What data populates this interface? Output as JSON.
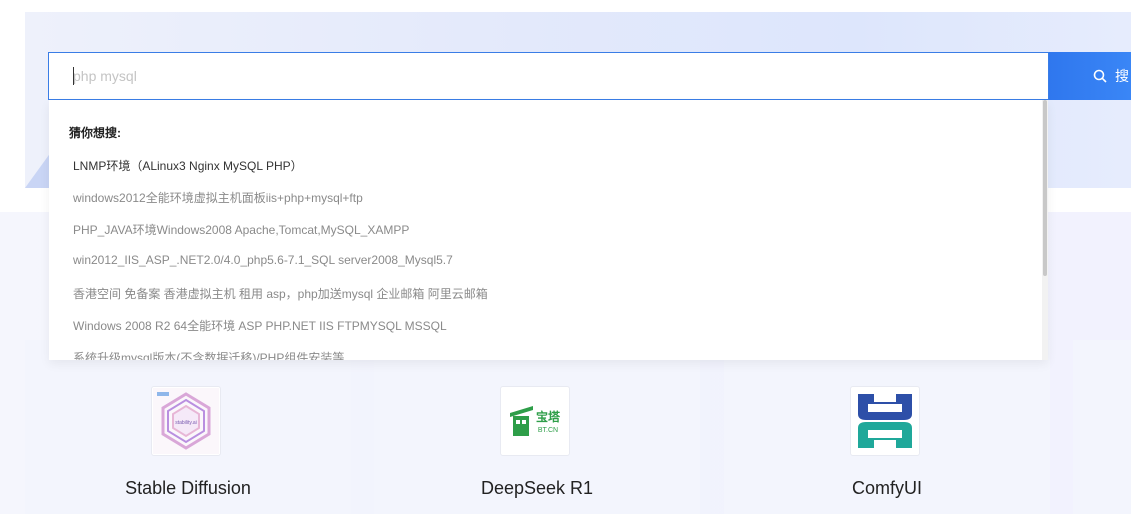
{
  "search": {
    "value": "",
    "placeholder": "php mysql",
    "button_label": "搜"
  },
  "suggestions": {
    "heading": "猜你想搜:",
    "items": [
      "LNMP环境（ALinux3 Nginx MySQL PHP）",
      "windows2012全能环境虚拟主机面板iis+php+mysql+ftp",
      "PHP_JAVA环境Windows2008 Apache,Tomcat,MySQL_XAMPP",
      "win2012_IIS_ASP_.NET2.0/4.0_php5.6-7.1_SQL server2008_Mysql5.7",
      "香港空间 免备案 香港虚拟主机 租用 asp，php加送mysql 企业邮箱 阿里云邮箱",
      "Windows 2008 R2 64全能环境 ASP PHP.NET IIS FTPMYSQL MSSQL",
      "系统升级mysql版本(不含数据迁移)/PHP组件安装等"
    ]
  },
  "cards": [
    {
      "title": "Stable Diffusion",
      "logo_text": "stability.ai",
      "icon": "stability-ai-logo"
    },
    {
      "title": "DeepSeek R1",
      "logo_text": "宝塔",
      "logo_subtext": "BT.CN",
      "icon": "bt-cn-logo"
    },
    {
      "title": "ComfyUI",
      "icon": "comfyui-logo"
    }
  ],
  "colors": {
    "accent": "#3a86f6",
    "input_border": "#3a7de6",
    "bt_green": "#2e9e49",
    "comfy_blue": "#2d4fa8",
    "comfy_teal": "#1fa89a"
  }
}
